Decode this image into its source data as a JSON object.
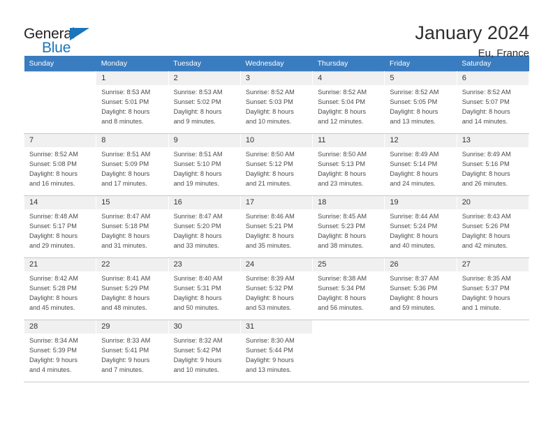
{
  "logo": {
    "general": "General",
    "blue": "Blue",
    "triangle_color": "#1a75bb"
  },
  "header": {
    "title": "January 2024",
    "subtitle": "Eu, France"
  },
  "colors": {
    "header_row": "#3a7cc0",
    "day_number_bg": "#f0f0f0",
    "grid_line": "#c8c8c8",
    "text": "#4a4a4a"
  },
  "weekday_headers": [
    "Sunday",
    "Monday",
    "Tuesday",
    "Wednesday",
    "Thursday",
    "Friday",
    "Saturday"
  ],
  "weeks": [
    [
      {
        "day": "",
        "sunrise": "",
        "sunset": "",
        "daylight1": "",
        "daylight2": ""
      },
      {
        "day": "1",
        "sunrise": "Sunrise: 8:53 AM",
        "sunset": "Sunset: 5:01 PM",
        "daylight1": "Daylight: 8 hours",
        "daylight2": "and 8 minutes."
      },
      {
        "day": "2",
        "sunrise": "Sunrise: 8:53 AM",
        "sunset": "Sunset: 5:02 PM",
        "daylight1": "Daylight: 8 hours",
        "daylight2": "and 9 minutes."
      },
      {
        "day": "3",
        "sunrise": "Sunrise: 8:52 AM",
        "sunset": "Sunset: 5:03 PM",
        "daylight1": "Daylight: 8 hours",
        "daylight2": "and 10 minutes."
      },
      {
        "day": "4",
        "sunrise": "Sunrise: 8:52 AM",
        "sunset": "Sunset: 5:04 PM",
        "daylight1": "Daylight: 8 hours",
        "daylight2": "and 12 minutes."
      },
      {
        "day": "5",
        "sunrise": "Sunrise: 8:52 AM",
        "sunset": "Sunset: 5:05 PM",
        "daylight1": "Daylight: 8 hours",
        "daylight2": "and 13 minutes."
      },
      {
        "day": "6",
        "sunrise": "Sunrise: 8:52 AM",
        "sunset": "Sunset: 5:07 PM",
        "daylight1": "Daylight: 8 hours",
        "daylight2": "and 14 minutes."
      }
    ],
    [
      {
        "day": "7",
        "sunrise": "Sunrise: 8:52 AM",
        "sunset": "Sunset: 5:08 PM",
        "daylight1": "Daylight: 8 hours",
        "daylight2": "and 16 minutes."
      },
      {
        "day": "8",
        "sunrise": "Sunrise: 8:51 AM",
        "sunset": "Sunset: 5:09 PM",
        "daylight1": "Daylight: 8 hours",
        "daylight2": "and 17 minutes."
      },
      {
        "day": "9",
        "sunrise": "Sunrise: 8:51 AM",
        "sunset": "Sunset: 5:10 PM",
        "daylight1": "Daylight: 8 hours",
        "daylight2": "and 19 minutes."
      },
      {
        "day": "10",
        "sunrise": "Sunrise: 8:50 AM",
        "sunset": "Sunset: 5:12 PM",
        "daylight1": "Daylight: 8 hours",
        "daylight2": "and 21 minutes."
      },
      {
        "day": "11",
        "sunrise": "Sunrise: 8:50 AM",
        "sunset": "Sunset: 5:13 PM",
        "daylight1": "Daylight: 8 hours",
        "daylight2": "and 23 minutes."
      },
      {
        "day": "12",
        "sunrise": "Sunrise: 8:49 AM",
        "sunset": "Sunset: 5:14 PM",
        "daylight1": "Daylight: 8 hours",
        "daylight2": "and 24 minutes."
      },
      {
        "day": "13",
        "sunrise": "Sunrise: 8:49 AM",
        "sunset": "Sunset: 5:16 PM",
        "daylight1": "Daylight: 8 hours",
        "daylight2": "and 26 minutes."
      }
    ],
    [
      {
        "day": "14",
        "sunrise": "Sunrise: 8:48 AM",
        "sunset": "Sunset: 5:17 PM",
        "daylight1": "Daylight: 8 hours",
        "daylight2": "and 29 minutes."
      },
      {
        "day": "15",
        "sunrise": "Sunrise: 8:47 AM",
        "sunset": "Sunset: 5:18 PM",
        "daylight1": "Daylight: 8 hours",
        "daylight2": "and 31 minutes."
      },
      {
        "day": "16",
        "sunrise": "Sunrise: 8:47 AM",
        "sunset": "Sunset: 5:20 PM",
        "daylight1": "Daylight: 8 hours",
        "daylight2": "and 33 minutes."
      },
      {
        "day": "17",
        "sunrise": "Sunrise: 8:46 AM",
        "sunset": "Sunset: 5:21 PM",
        "daylight1": "Daylight: 8 hours",
        "daylight2": "and 35 minutes."
      },
      {
        "day": "18",
        "sunrise": "Sunrise: 8:45 AM",
        "sunset": "Sunset: 5:23 PM",
        "daylight1": "Daylight: 8 hours",
        "daylight2": "and 38 minutes."
      },
      {
        "day": "19",
        "sunrise": "Sunrise: 8:44 AM",
        "sunset": "Sunset: 5:24 PM",
        "daylight1": "Daylight: 8 hours",
        "daylight2": "and 40 minutes."
      },
      {
        "day": "20",
        "sunrise": "Sunrise: 8:43 AM",
        "sunset": "Sunset: 5:26 PM",
        "daylight1": "Daylight: 8 hours",
        "daylight2": "and 42 minutes."
      }
    ],
    [
      {
        "day": "21",
        "sunrise": "Sunrise: 8:42 AM",
        "sunset": "Sunset: 5:28 PM",
        "daylight1": "Daylight: 8 hours",
        "daylight2": "and 45 minutes."
      },
      {
        "day": "22",
        "sunrise": "Sunrise: 8:41 AM",
        "sunset": "Sunset: 5:29 PM",
        "daylight1": "Daylight: 8 hours",
        "daylight2": "and 48 minutes."
      },
      {
        "day": "23",
        "sunrise": "Sunrise: 8:40 AM",
        "sunset": "Sunset: 5:31 PM",
        "daylight1": "Daylight: 8 hours",
        "daylight2": "and 50 minutes."
      },
      {
        "day": "24",
        "sunrise": "Sunrise: 8:39 AM",
        "sunset": "Sunset: 5:32 PM",
        "daylight1": "Daylight: 8 hours",
        "daylight2": "and 53 minutes."
      },
      {
        "day": "25",
        "sunrise": "Sunrise: 8:38 AM",
        "sunset": "Sunset: 5:34 PM",
        "daylight1": "Daylight: 8 hours",
        "daylight2": "and 56 minutes."
      },
      {
        "day": "26",
        "sunrise": "Sunrise: 8:37 AM",
        "sunset": "Sunset: 5:36 PM",
        "daylight1": "Daylight: 8 hours",
        "daylight2": "and 59 minutes."
      },
      {
        "day": "27",
        "sunrise": "Sunrise: 8:35 AM",
        "sunset": "Sunset: 5:37 PM",
        "daylight1": "Daylight: 9 hours",
        "daylight2": "and 1 minute."
      }
    ],
    [
      {
        "day": "28",
        "sunrise": "Sunrise: 8:34 AM",
        "sunset": "Sunset: 5:39 PM",
        "daylight1": "Daylight: 9 hours",
        "daylight2": "and 4 minutes."
      },
      {
        "day": "29",
        "sunrise": "Sunrise: 8:33 AM",
        "sunset": "Sunset: 5:41 PM",
        "daylight1": "Daylight: 9 hours",
        "daylight2": "and 7 minutes."
      },
      {
        "day": "30",
        "sunrise": "Sunrise: 8:32 AM",
        "sunset": "Sunset: 5:42 PM",
        "daylight1": "Daylight: 9 hours",
        "daylight2": "and 10 minutes."
      },
      {
        "day": "31",
        "sunrise": "Sunrise: 8:30 AM",
        "sunset": "Sunset: 5:44 PM",
        "daylight1": "Daylight: 9 hours",
        "daylight2": "and 13 minutes."
      },
      {
        "day": "",
        "sunrise": "",
        "sunset": "",
        "daylight1": "",
        "daylight2": ""
      },
      {
        "day": "",
        "sunrise": "",
        "sunset": "",
        "daylight1": "",
        "daylight2": ""
      },
      {
        "day": "",
        "sunrise": "",
        "sunset": "",
        "daylight1": "",
        "daylight2": ""
      }
    ]
  ]
}
